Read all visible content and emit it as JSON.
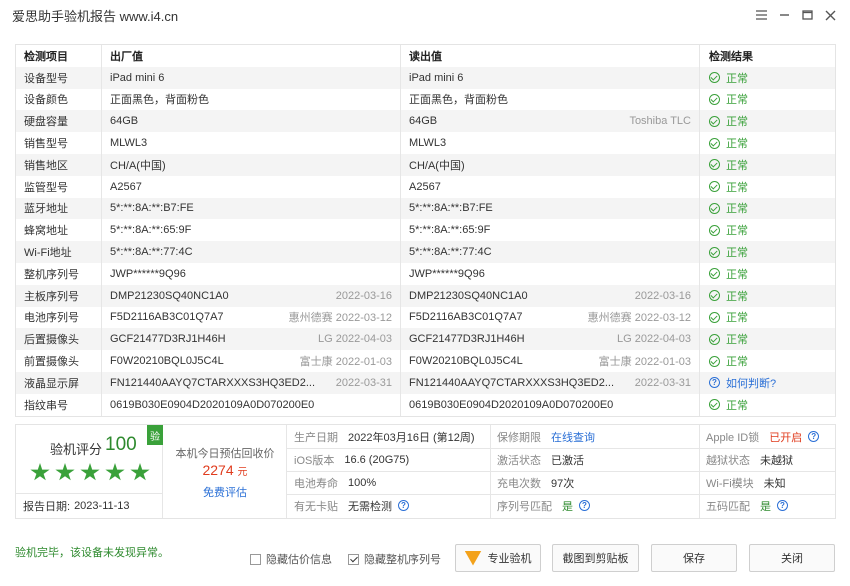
{
  "window": {
    "title": "爱思助手验机报告 www.i4.cn"
  },
  "table": {
    "headers": [
      "检测项目",
      "出厂值",
      "读出值",
      "检测结果"
    ],
    "rows": [
      {
        "item": "设备型号",
        "factory": "iPad mini 6",
        "factory_note": "",
        "read": "iPad mini 6",
        "read_note": "",
        "result": "正常",
        "status": "ok"
      },
      {
        "item": "设备颜色",
        "factory": "正面黑色，背面粉色",
        "factory_note": "",
        "read": "正面黑色，背面粉色",
        "read_note": "",
        "result": "正常",
        "status": "ok"
      },
      {
        "item": "硬盘容量",
        "factory": "64GB",
        "factory_note": "",
        "read": "64GB",
        "read_note": "Toshiba TLC",
        "result": "正常",
        "status": "ok"
      },
      {
        "item": "销售型号",
        "factory": "MLWL3",
        "factory_note": "",
        "read": "MLWL3",
        "read_note": "",
        "result": "正常",
        "status": "ok"
      },
      {
        "item": "销售地区",
        "factory": "CH/A(中国)",
        "factory_note": "",
        "read": "CH/A(中国)",
        "read_note": "",
        "result": "正常",
        "status": "ok"
      },
      {
        "item": "监管型号",
        "factory": "A2567",
        "factory_note": "",
        "read": "A2567",
        "read_note": "",
        "result": "正常",
        "status": "ok"
      },
      {
        "item": "蓝牙地址",
        "factory": "5*:**:8A:**:B7:FE",
        "factory_note": "",
        "read": "5*:**:8A:**:B7:FE",
        "read_note": "",
        "result": "正常",
        "status": "ok"
      },
      {
        "item": "蜂窝地址",
        "factory": "5*:**:8A:**:65:9F",
        "factory_note": "",
        "read": "5*:**:8A:**:65:9F",
        "read_note": "",
        "result": "正常",
        "status": "ok"
      },
      {
        "item": "Wi-Fi地址",
        "factory": "5*:**:8A:**:77:4C",
        "factory_note": "",
        "read": "5*:**:8A:**:77:4C",
        "read_note": "",
        "result": "正常",
        "status": "ok"
      },
      {
        "item": "整机序列号",
        "factory": "JWP******9Q96",
        "factory_note": "",
        "read": "JWP******9Q96",
        "read_note": "",
        "result": "正常",
        "status": "ok"
      },
      {
        "item": "主板序列号",
        "factory": "DMP21230SQ40NC1A0",
        "factory_note": "2022-03-16",
        "read": "DMP21230SQ40NC1A0",
        "read_note": "2022-03-16",
        "result": "正常",
        "status": "ok"
      },
      {
        "item": "电池序列号",
        "factory": "F5D2116AB3C01Q7A7",
        "factory_note": "惠州德赛 2022-03-12",
        "read": "F5D2116AB3C01Q7A7",
        "read_note": "惠州德赛 2022-03-12",
        "result": "正常",
        "status": "ok"
      },
      {
        "item": "后置摄像头",
        "factory": "GCF21477D3RJ1H46H",
        "factory_note": "LG 2022-04-03",
        "read": "GCF21477D3RJ1H46H",
        "read_note": "LG 2022-04-03",
        "result": "正常",
        "status": "ok"
      },
      {
        "item": "前置摄像头",
        "factory": "F0W20210BQL0J5C4L",
        "factory_note": "富士康 2022-01-03",
        "read": "F0W20210BQL0J5C4L",
        "read_note": "富士康 2022-01-03",
        "result": "正常",
        "status": "ok"
      },
      {
        "item": "液晶显示屏",
        "factory": "FN121440AAYQ7CTARXXXS3HQ3ED2...",
        "factory_note": "2022-03-31",
        "read": "FN121440AAYQ7CTARXXXS3HQ3ED2...",
        "read_note": "2022-03-31",
        "result": "如何判断?",
        "status": "question"
      },
      {
        "item": "指纹串号",
        "factory": "0619B030E0904D2020109A0D070200E0",
        "factory_note": "",
        "read": "0619B030E0904D2020109A0D070200E0",
        "read_note": "",
        "result": "正常",
        "status": "ok"
      }
    ]
  },
  "summary": {
    "score_label": "验机评分",
    "score": "100",
    "badge": "验",
    "stars": 5,
    "report_date_label": "报告日期:",
    "report_date": "2023-11-13",
    "price_label": "本机今日预估回收价",
    "price": "2274",
    "price_unit": "元",
    "price_link": "免费评估",
    "grid": [
      {
        "label": "生产日期",
        "value": "2022年03月16日 (第12周)",
        "style": ""
      },
      {
        "label": "保修期限",
        "value": "在线查询",
        "style": "link"
      },
      {
        "label": "Apple ID锁",
        "value": "已开启",
        "style": "red"
      },
      {
        "label": "iOS版本",
        "value": "16.6 (20G75)",
        "style": ""
      },
      {
        "label": "激活状态",
        "value": "已激活",
        "style": ""
      },
      {
        "label": "越狱状态",
        "value": "未越狱",
        "style": ""
      },
      {
        "label": "电池寿命",
        "value": "100%",
        "style": ""
      },
      {
        "label": "充电次数",
        "value": "97次",
        "style": ""
      },
      {
        "label": "Wi-Fi模块",
        "value": "未知",
        "style": ""
      },
      {
        "label": "有无卡贴",
        "value": "无需检测",
        "style": ""
      },
      {
        "label": "序列号匹配",
        "value": "是",
        "style": "green"
      },
      {
        "label": "五码匹配",
        "value": "是",
        "style": "green"
      }
    ]
  },
  "footer": {
    "message": "验机完毕，该设备未发现异常。",
    "hide_price_label": "隐藏估价信息",
    "hide_price_checked": false,
    "hide_serial_label": "隐藏整机序列号",
    "hide_serial_checked": true,
    "pro_button": "专业验机",
    "screenshot_button": "截图到剪贴板",
    "save_button": "保存",
    "close_button": "关闭"
  }
}
